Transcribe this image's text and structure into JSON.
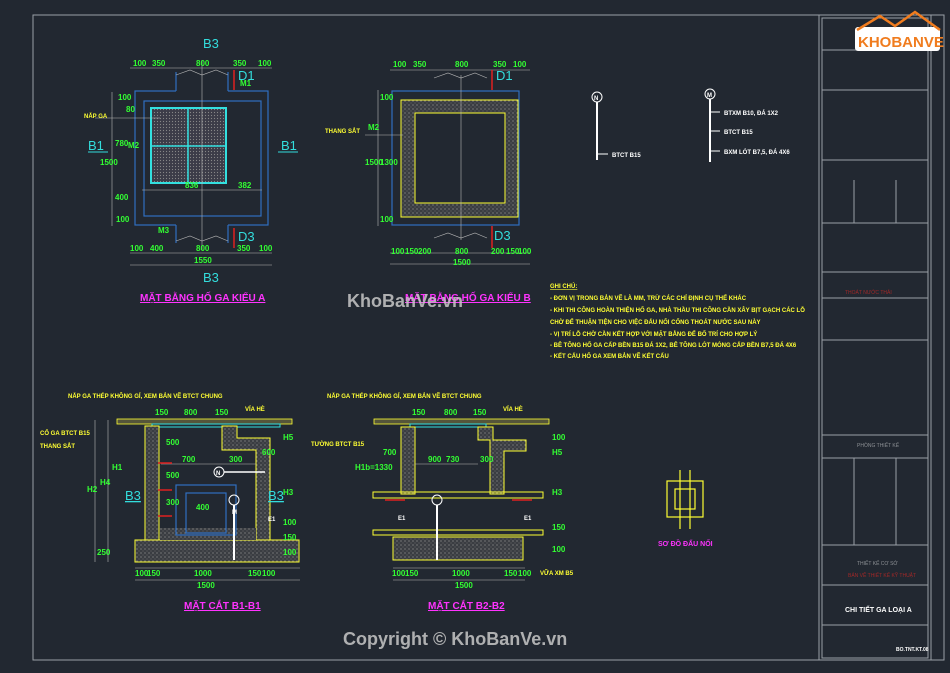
{
  "drawing": {
    "plan_a": {
      "title": "MẶT BẰNG HỐ GA KIỂU A",
      "section_b1": "B1",
      "section_b3": "B3",
      "section_d1": "D1",
      "section_d3": "D3",
      "cover_label": "NẮP GA",
      "dims_top": [
        "100",
        "350",
        "800",
        "350",
        "100"
      ],
      "dims_bottom": [
        "100",
        "400",
        "800",
        "350",
        "100"
      ],
      "total": "1550",
      "dims_left": [
        "100",
        "80",
        "780",
        "400",
        "100"
      ],
      "height_total": "1500",
      "inner_dims": [
        "836",
        "382"
      ],
      "tags": [
        "M1",
        "M3",
        "M2"
      ]
    },
    "plan_b": {
      "title": "MẶT BẰNG HỐ GA KIỂU B",
      "section_d1": "D1",
      "section_d3": "D3",
      "ladder_label": "THANG SẮT",
      "dims_top": [
        "100",
        "350",
        "800",
        "350",
        "100"
      ],
      "dims_bottom": [
        "100",
        "150",
        "200",
        "800",
        "200",
        "150",
        "100"
      ],
      "total": "1500",
      "dims_left": [
        "100",
        "1300",
        "100"
      ],
      "height_total": "1500",
      "tag": "M2"
    },
    "legend_n": {
      "symbol": "N",
      "items": [
        "BTCT B15"
      ]
    },
    "legend_m": {
      "symbol": "M",
      "items": [
        "BTXM B10, ĐÁ 1X2",
        "BTCT B15",
        "BXM LÓT B7,5, ĐÁ 4X6"
      ]
    },
    "notes": {
      "heading": "GHI CHÚ:",
      "lines": [
        "- ĐƠN VỊ TRONG BẢN VẼ LÀ MM, TRỪ CÁC CHỈ ĐỊNH CỤ THỂ KHÁC",
        "- KHI THI CÔNG HOÀN THIỆN HỐ GA, NHÀ THẦU THI CÔNG CẦN XÂY BỊT GẠCH CÁC LỖ",
        "CHỜ ĐỂ THUẬN TIỆN CHO VIỆC ĐẤU NỐI CỐNG THOÁT NƯỚC SAU NÀY",
        "- VỊ TRÍ LỖ CHỜ CẦN KẾT HỢP VỚI MẶT BẰNG ĐỂ BỐ TRÍ CHO HỢP LÝ",
        "- BÊ TÔNG HỐ GA CẤP BỀN B15 ĐÁ 1X2, BÊ TÔNG LÓT MÓNG CẤP BỀN B7,5 ĐÁ 4X6",
        "- KẾT CẤU HỐ GA XEM BẢN VẼ KẾT CẤU"
      ]
    },
    "section_b1": {
      "title": "MẶT CẮT B1-B1",
      "cover_note": "NẮP GA THÉP KHÔNG GỈ, XEM BẢN VẼ BTCT CHUNG",
      "curb": "VỈA HÈ",
      "neck": "CỔ GA BTCT B15",
      "ladder": "THANG SẮT",
      "tag_b3": "B3",
      "tag_e1": "E1",
      "tag_n": "N",
      "tag_m": "M",
      "dims": [
        "150",
        "800",
        "150",
        "500",
        "700",
        "300",
        "500",
        "300",
        "400",
        "600",
        "100",
        "150",
        "100",
        "250"
      ],
      "bottom": [
        "100",
        "150",
        "1000",
        "150",
        "100"
      ],
      "total": "1500",
      "side_labels": [
        "H1",
        "H2",
        "H4",
        "H3",
        "H5"
      ]
    },
    "section_b2": {
      "title": "MẶT CẮT B2-B2",
      "cover_note": "NẮP GA THÉP KHÔNG GỈ, XEM BẢN VẼ BTCT CHUNG",
      "curb": "VỈA HÈ",
      "wall": "TƯỜNG BTCT B15",
      "height": "H1b=1330",
      "mortar": "VỮA XM B5",
      "tag_e1": "E1",
      "dims": [
        "150",
        "800",
        "150",
        "700",
        "900",
        "730",
        "300",
        "100",
        "150",
        "100"
      ],
      "bottom": [
        "100",
        "150",
        "1000",
        "150",
        "100"
      ],
      "total": "1500",
      "side_labels": [
        "H5",
        "H3"
      ]
    },
    "connection": {
      "title": "SƠ ĐỒ ĐẤU NỐI"
    }
  },
  "title_block": {
    "project_type": "THOÁT NƯỚC THẢI",
    "design_room": "PHÒNG THIẾT KẾ",
    "design_basis": "THIẾT KẾ CƠ SỞ",
    "design_stage": "BẢN VẼ THIẾT KẾ KỸ THUẬT",
    "sheet_title": "CHI TIẾT GA LOẠI A",
    "drawing_no": "BO.TNT.KT.08"
  },
  "watermarks": {
    "logo": "KHOBANVE",
    "center": "KhoBanVe.vn",
    "copyright": "Copyright © KhoBanVe.vn"
  },
  "colors": {
    "background": "#222831",
    "dimension": "#33ff33",
    "annotation": "#ffff33",
    "section_tag": "#33dddd",
    "title": "#ff33ff",
    "accent_logo": "#f07c1e"
  }
}
